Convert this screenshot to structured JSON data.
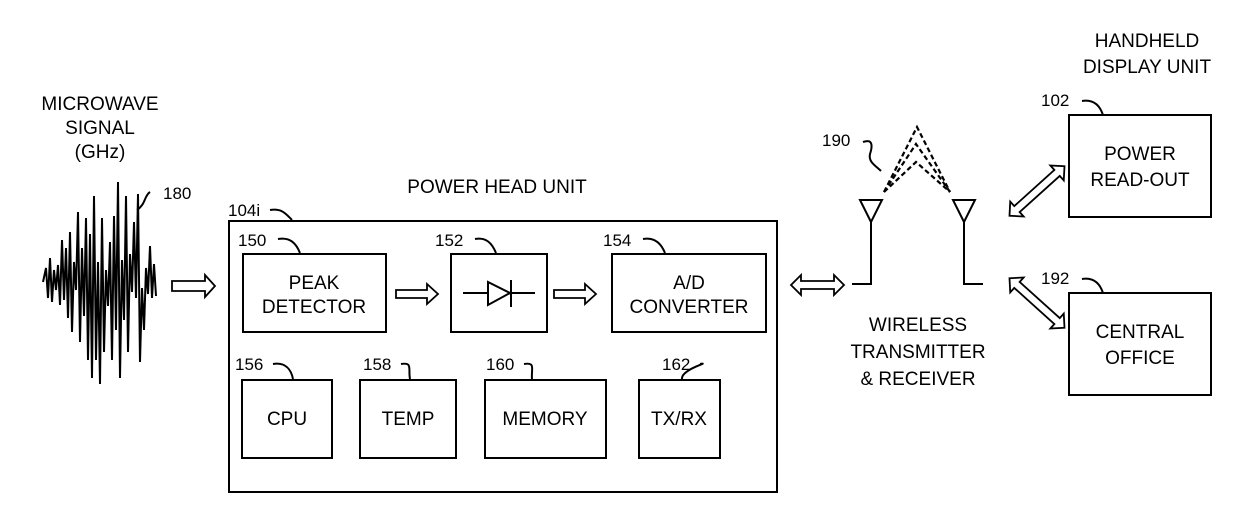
{
  "figure": {
    "signal": {
      "title_lines": [
        "MICROWAVE",
        "SIGNAL",
        "(GHz)"
      ],
      "ref": "180"
    },
    "power_head_unit": {
      "title": "POWER HEAD UNIT",
      "ref": "104i",
      "blocks": {
        "peak_detector": {
          "ref": "150",
          "lines": [
            "PEAK",
            "DETECTOR"
          ]
        },
        "diode": {
          "ref": "152",
          "icon": "diode-icon"
        },
        "ad_converter": {
          "ref": "154",
          "lines": [
            "A/D",
            "CONVERTER"
          ]
        },
        "cpu": {
          "ref": "156",
          "lines": [
            "CPU"
          ]
        },
        "temp": {
          "ref": "158",
          "lines": [
            "TEMP"
          ]
        },
        "memory": {
          "ref": "160",
          "lines": [
            "MEMORY"
          ]
        },
        "txrx": {
          "ref": "162",
          "lines": [
            "TX/RX"
          ]
        }
      }
    },
    "wireless": {
      "ref": "190",
      "title_lines": [
        "WIRELESS",
        "TRANSMITTER",
        "& RECEIVER"
      ],
      "icon": "antenna-icon"
    },
    "handheld": {
      "title_lines": [
        "HANDHELD",
        "DISPLAY UNIT"
      ],
      "power_readout": {
        "ref": "102",
        "lines": [
          "POWER",
          "READ-OUT"
        ]
      }
    },
    "central_office": {
      "ref": "192",
      "lines": [
        "CENTRAL",
        "OFFICE"
      ]
    }
  }
}
